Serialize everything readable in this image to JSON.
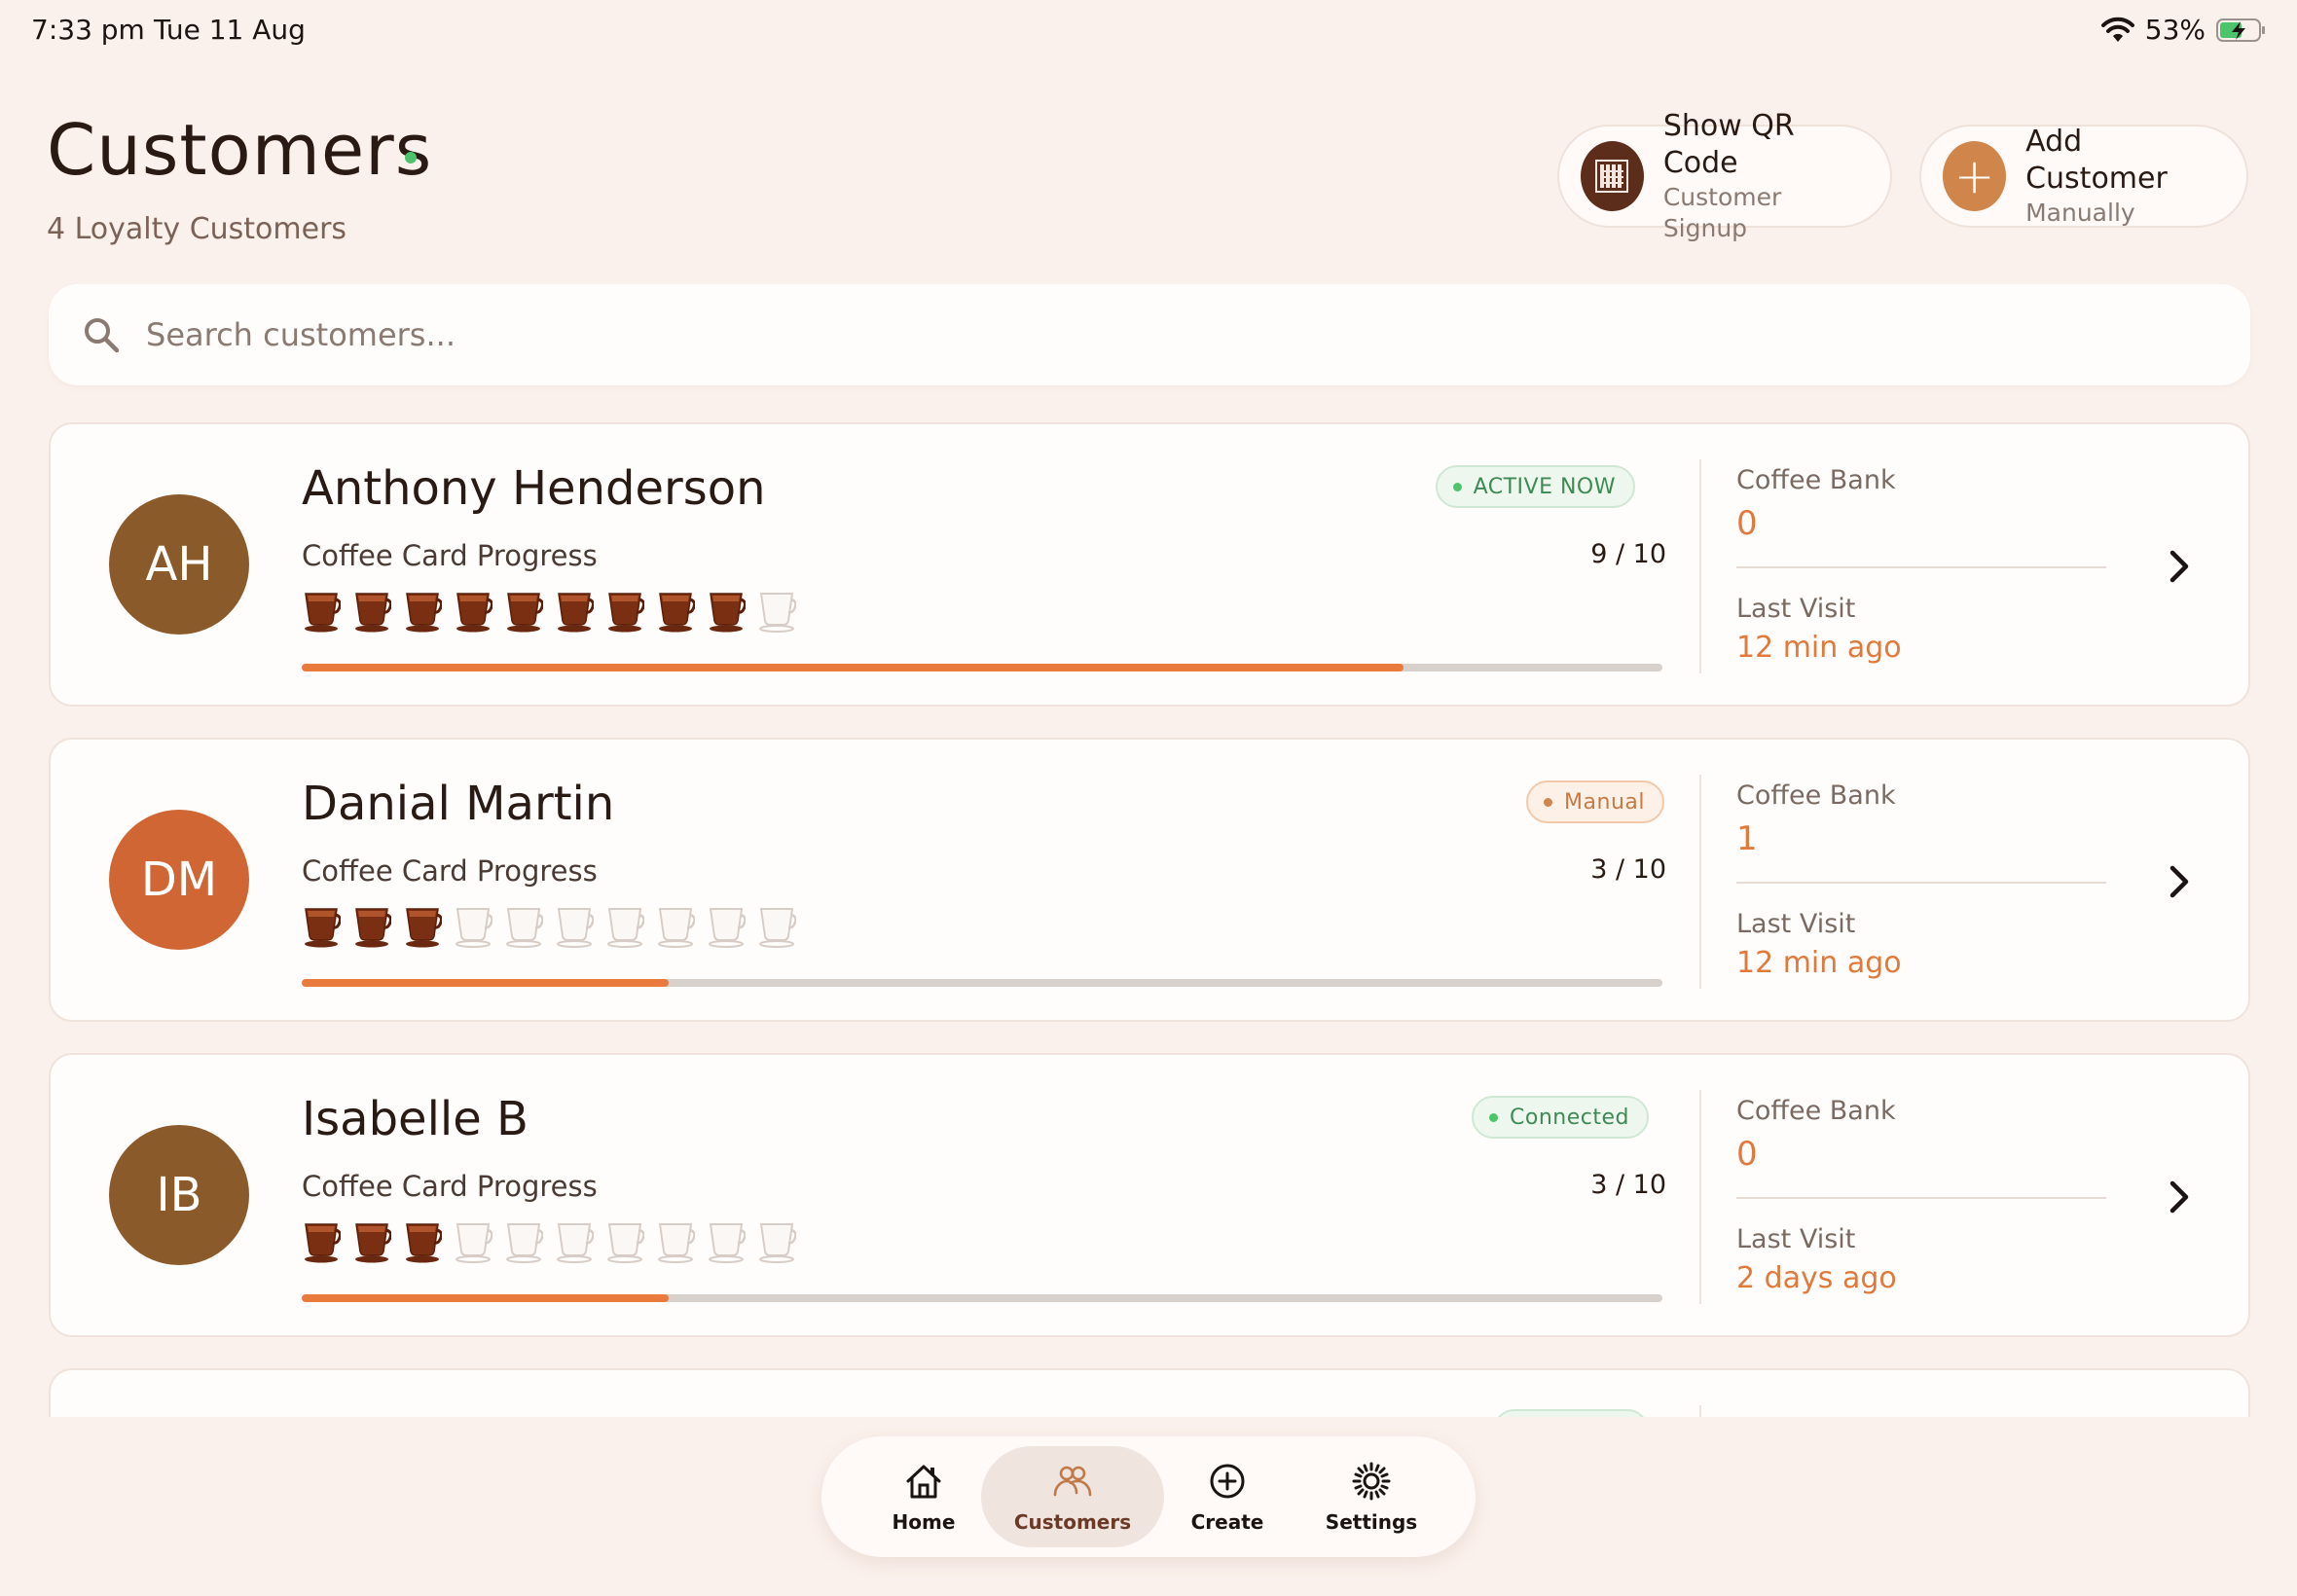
{
  "status_bar": {
    "time": "7:33 pm",
    "date": "Tue 11 Aug",
    "battery": "53%"
  },
  "header": {
    "title": "Customers",
    "subtitle": "4 Loyalty Customers",
    "qr_button": {
      "label": "Show QR Code",
      "sublabel": "Customer Signup"
    },
    "add_button": {
      "label": "Add Customer",
      "sublabel": "Manually",
      "icon": "+"
    }
  },
  "search": {
    "placeholder": "Search customers..."
  },
  "labels": {
    "progress": "Coffee Card Progress",
    "bank": "Coffee Bank",
    "last_visit": "Last Visit"
  },
  "colors": {
    "accent": "#e07a3c",
    "active_green": "#4cc46a",
    "qr_brown": "#5b2d1a"
  },
  "customers": [
    {
      "initials": "AH",
      "name": "Anthony Henderson",
      "badge": "ACTIVE NOW",
      "badge_type": "green",
      "stamps": 9,
      "total": 10,
      "progress": "9 / 10",
      "bank": "0",
      "last_visit": "12 min ago",
      "avatar_color": "#8b5a2b"
    },
    {
      "initials": "DM",
      "name": "Danial Martin",
      "badge": "Manual",
      "badge_type": "orange",
      "stamps": 3,
      "total": 10,
      "progress": "3 / 10",
      "bank": "1",
      "last_visit": "12 min ago",
      "avatar_color": "#d06634"
    },
    {
      "initials": "IB",
      "name": "Isabelle B",
      "badge": "Connected",
      "badge_type": "green",
      "stamps": 3,
      "total": 10,
      "progress": "3 / 10",
      "bank": "0",
      "last_visit": "2 days ago",
      "avatar_color": "#8b5a2b"
    }
  ],
  "nav": [
    {
      "label": "Home",
      "icon": "home-icon"
    },
    {
      "label": "Customers",
      "icon": "customers-icon"
    },
    {
      "label": "Create",
      "icon": "create-icon"
    },
    {
      "label": "Settings",
      "icon": "settings-icon"
    }
  ]
}
